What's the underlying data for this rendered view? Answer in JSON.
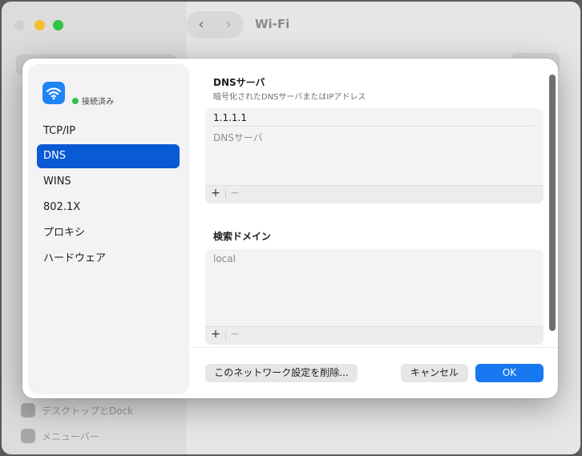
{
  "background": {
    "title": "Wi-Fi",
    "sidebar_items": [
      {
        "label": "デスクトップとDock"
      },
      {
        "label": "メニューバー"
      }
    ]
  },
  "sheet": {
    "network": {
      "name": "",
      "status": "接続済み"
    },
    "sidebar_items": [
      {
        "label": "TCP/IP",
        "selected": false
      },
      {
        "label": "DNS",
        "selected": true
      },
      {
        "label": "WINS",
        "selected": false
      },
      {
        "label": "802.1X",
        "selected": false
      },
      {
        "label": "プロキシ",
        "selected": false
      },
      {
        "label": "ハードウェア",
        "selected": false
      }
    ],
    "dns": {
      "title": "DNSサーバ",
      "subtitle": "暗号化されたDNSサーバまたはIPアドレス",
      "entries": [
        "1.1.1.1"
      ],
      "placeholder": "DNSサーバ"
    },
    "search_domains": {
      "title": "検索ドメイン",
      "entries": [
        "local"
      ]
    },
    "footer": {
      "plus": "+",
      "minus": "−"
    },
    "buttons": {
      "delete": "このネットワーク設定を削除...",
      "cancel": "キャンセル",
      "ok": "OK"
    }
  },
  "colors": {
    "accent": "#1778f2",
    "selected": "#0a5ad4",
    "status_green": "#2fc24a",
    "wifi_blue": "#1f84f6"
  }
}
